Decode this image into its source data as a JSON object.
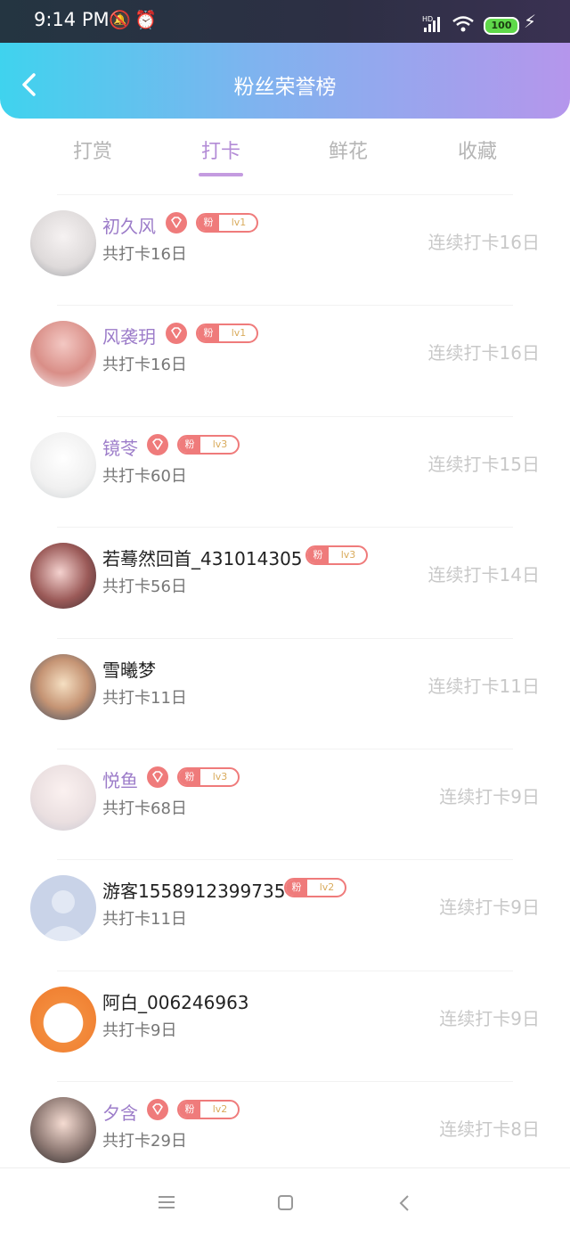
{
  "status_bar": {
    "time": "9:14 PM",
    "battery": "100"
  },
  "header": {
    "title": "粉丝荣誉榜"
  },
  "tabs": [
    {
      "label": "打赏"
    },
    {
      "label": "打卡"
    },
    {
      "label": "鲜花"
    },
    {
      "label": "收藏"
    }
  ],
  "active_tab": "打卡",
  "badge": {
    "fan_label": "粉"
  },
  "colors": {
    "accent": "#b38bd6",
    "badge": "#ef7b7b",
    "level": "#d9ab5c"
  },
  "list": [
    {
      "name": "初久风",
      "count": "共打卡16日",
      "streak": "连续打卡16日",
      "level": "lv1",
      "highlight": true
    },
    {
      "name": "风袭玥",
      "count": "共打卡16日",
      "streak": "连续打卡16日",
      "level": "lv1",
      "highlight": true
    },
    {
      "name": "镜苓",
      "count": "共打卡60日",
      "streak": "连续打卡15日",
      "level": "lv3",
      "highlight": true
    },
    {
      "name": "若蓦然回首_431014305",
      "count": "共打卡56日",
      "streak": "连续打卡14日",
      "level": "lv3",
      "highlight": false
    },
    {
      "name": "雪曦梦",
      "count": "共打卡11日",
      "streak": "连续打卡11日",
      "level": "",
      "highlight": false
    },
    {
      "name": "悦鱼",
      "count": "共打卡68日",
      "streak": "连续打卡9日",
      "level": "lv3",
      "highlight": true
    },
    {
      "name": "游客1558912399735",
      "count": "共打卡11日",
      "streak": "连续打卡9日",
      "level": "lv2",
      "highlight": false
    },
    {
      "name": "阿白_006246963",
      "count": "共打卡9日",
      "streak": "连续打卡9日",
      "level": "",
      "highlight": false
    },
    {
      "name": "夕含",
      "count": "共打卡29日",
      "streak": "连续打卡8日",
      "level": "lv2",
      "highlight": true
    }
  ]
}
